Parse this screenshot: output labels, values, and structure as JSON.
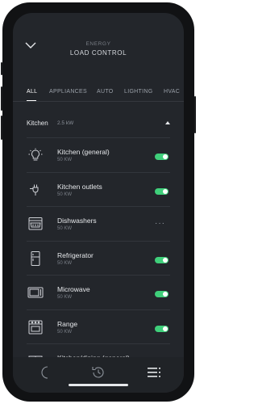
{
  "header": {
    "supertitle": "ENERGY",
    "title": "LOAD CONTROL",
    "back_icon": "chevron-down-icon"
  },
  "tabs": [
    "ALL",
    "APPLIANCES",
    "AUTO",
    "LIGHTING",
    "HVAC"
  ],
  "active_tab": "ALL",
  "section": {
    "title": "Kitchen",
    "power": "2.5 kW",
    "icon": "caret-up-icon"
  },
  "rows": [
    {
      "name": "Kitchen (general)",
      "power": "50 KW",
      "icon": "lightbulb-icon",
      "state": "on"
    },
    {
      "name": "Kitchen outlets",
      "power": "50 KW",
      "icon": "plug-icon",
      "state": "on"
    },
    {
      "name": "Dishwashers",
      "power": "50 KW",
      "icon": "dishwasher-icon",
      "state": "more"
    },
    {
      "name": "Refrigerator",
      "power": "50 KW",
      "icon": "refrigerator-icon",
      "state": "on"
    },
    {
      "name": "Microwave",
      "power": "50 KW",
      "icon": "microwave-icon",
      "state": "on"
    },
    {
      "name": "Range",
      "power": "50 KW",
      "icon": "range-icon",
      "state": "on"
    },
    {
      "name": "Kitchen/dining (general)",
      "power": "",
      "icon": "room-icon",
      "state": "on"
    }
  ],
  "more_label": "···",
  "bottom_nav": [
    "moon-icon",
    "clock-icon",
    "menu-icon"
  ],
  "colors": {
    "toggle_on": "#3fcf7a",
    "screen_bg": "#23262b"
  }
}
